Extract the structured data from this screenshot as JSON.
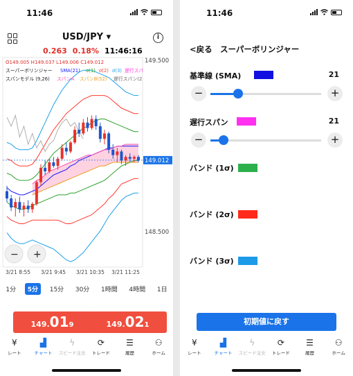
{
  "status": {
    "time": "11:46"
  },
  "chart_screen": {
    "pair": "USD/JPY",
    "change": "0.263",
    "change_pct": "0.18%",
    "clock": "11:46:16",
    "ohlc_line": "O149.005 H149.037 L149.006 C149.012",
    "legend_bb": {
      "prefix": "スーパーボリンジャー",
      "sma": "SMA(21)",
      "s1": "σ(1)",
      "s2": "σ(2)",
      "s3": "σ(3)",
      "lag": "遅行スパ"
    },
    "legend_span": {
      "prefix": "スパンモデル (9,26)",
      "a": "スパンA",
      "b": "スパンB(52)",
      "lag": "遅行スパン(2"
    },
    "price_labels": {
      "top": "149.500",
      "current": "149.012",
      "bottom": "148.500"
    },
    "time_labels": [
      "3/21 8:55",
      "3/21 9:45",
      "3/21 10:35",
      "3/21 11:25"
    ],
    "timeframes": [
      "1分",
      "5分",
      "15分",
      "30分",
      "1時間",
      "4時間",
      "1日"
    ],
    "selected_timeframe": "5分",
    "sell": {
      "small": "149.",
      "big": "01",
      "tail": "9"
    },
    "buy": {
      "small": "149.",
      "big": "02",
      "tail": "1"
    },
    "colors": {
      "price_red": "#f04e3e",
      "sma": "#1a1aff",
      "sigma1": "#2ca02c",
      "sigma2": "#ff3b30",
      "sigma3": "#1ca0e8",
      "lag": "#ff3de0"
    },
    "chart_data": {
      "type": "line",
      "title": "USD/JPY 5分",
      "ylim": [
        148.42,
        149.58
      ],
      "x": [
        "3/21 8:55",
        "3/21 9:45",
        "3/21 10:35",
        "3/21 11:25"
      ],
      "candles": [
        [
          148.84,
          148.87,
          148.78,
          148.8
        ],
        [
          148.8,
          148.82,
          148.73,
          148.75
        ],
        [
          148.75,
          148.8,
          148.7,
          148.78
        ],
        [
          148.78,
          148.81,
          148.72,
          148.74
        ],
        [
          148.74,
          148.78,
          148.7,
          148.76
        ],
        [
          148.76,
          148.79,
          148.72,
          148.74
        ],
        [
          148.74,
          148.78,
          148.72,
          148.77
        ],
        [
          148.77,
          148.9,
          148.76,
          148.89
        ],
        [
          148.89,
          148.99,
          148.87,
          148.97
        ],
        [
          148.97,
          149.01,
          148.93,
          148.95
        ],
        [
          148.95,
          149.02,
          148.94,
          149.0
        ],
        [
          149.0,
          149.03,
          148.97,
          148.98
        ],
        [
          148.98,
          149.03,
          148.96,
          149.02
        ],
        [
          149.02,
          149.1,
          149.01,
          149.08
        ],
        [
          149.08,
          149.11,
          149.04,
          149.06
        ],
        [
          149.06,
          149.12,
          149.05,
          149.11
        ],
        [
          149.11,
          149.2,
          149.1,
          149.18
        ],
        [
          149.18,
          149.22,
          149.14,
          149.16
        ],
        [
          149.16,
          149.24,
          149.15,
          149.22
        ],
        [
          149.22,
          149.25,
          149.17,
          149.19
        ],
        [
          149.19,
          149.26,
          149.18,
          149.24
        ],
        [
          149.24,
          149.26,
          149.18,
          149.2
        ],
        [
          149.2,
          149.22,
          149.11,
          149.13
        ],
        [
          149.13,
          149.18,
          149.1,
          149.16
        ],
        [
          149.16,
          149.17,
          149.05,
          149.07
        ],
        [
          149.07,
          149.1,
          149.02,
          149.04
        ],
        [
          149.04,
          149.08,
          149.0,
          149.06
        ],
        [
          149.06,
          149.07,
          148.99,
          149.01
        ],
        [
          149.01,
          149.04,
          148.98,
          149.03
        ],
        [
          149.03,
          149.05,
          149.0,
          149.02
        ],
        [
          149.02,
          149.04,
          149.0,
          149.03
        ],
        [
          149.03,
          149.04,
          149.0,
          149.01
        ]
      ],
      "series": [
        {
          "name": "SMA(21)",
          "color": "#1a1aff",
          "values": [
            148.86,
            148.84,
            148.83,
            148.82,
            148.82,
            148.83,
            148.84,
            148.85,
            148.87,
            148.89,
            148.91,
            148.93,
            148.94,
            148.95,
            148.96,
            148.98,
            148.99,
            149.01,
            149.02,
            149.03,
            149.04,
            149.05,
            149.06,
            149.07,
            149.08,
            149.08,
            149.09,
            149.09,
            149.09,
            149.09,
            149.09,
            149.09
          ]
        },
        {
          "name": "σ(1)+",
          "color": "#2ca02c",
          "values": [
            148.94,
            148.93,
            148.91,
            148.9,
            148.9,
            148.9,
            148.91,
            148.93,
            148.96,
            148.99,
            149.02,
            149.05,
            149.07,
            149.09,
            149.11,
            149.13,
            149.15,
            149.17,
            149.19,
            149.2,
            149.22,
            149.23,
            149.24,
            149.24,
            149.23,
            149.22,
            149.21,
            149.2,
            149.19,
            149.18,
            149.17,
            149.17
          ]
        },
        {
          "name": "σ(1)-",
          "color": "#2ca02c",
          "values": [
            148.78,
            148.76,
            148.75,
            148.74,
            148.74,
            148.75,
            148.76,
            148.77,
            148.78,
            148.79,
            148.8,
            148.81,
            148.82,
            148.82,
            148.82,
            148.83,
            148.83,
            148.84,
            148.85,
            148.86,
            148.87,
            148.88,
            148.89,
            148.9,
            148.92,
            148.94,
            148.96,
            148.98,
            148.99,
            149.0,
            149.01,
            149.01
          ]
        },
        {
          "name": "σ(2)+",
          "color": "#ff3b30",
          "values": [
            149.02,
            149.01,
            148.99,
            148.98,
            148.98,
            148.98,
            148.99,
            149.02,
            149.06,
            149.1,
            149.14,
            149.18,
            149.21,
            149.24,
            149.27,
            149.29,
            149.31,
            149.33,
            149.35,
            149.36,
            149.37,
            149.37,
            149.37,
            149.37,
            149.36,
            149.34,
            149.32,
            149.3,
            149.29,
            149.28,
            149.27,
            149.27
          ]
        },
        {
          "name": "σ(2)-",
          "color": "#ff3b30",
          "values": [
            148.7,
            148.68,
            148.67,
            148.66,
            148.66,
            148.67,
            148.68,
            148.68,
            148.68,
            148.68,
            148.68,
            148.68,
            148.68,
            148.67,
            148.66,
            148.66,
            148.67,
            148.68,
            148.69,
            148.7,
            148.71,
            148.73,
            148.75,
            148.77,
            148.8,
            148.82,
            148.85,
            148.88,
            148.89,
            148.9,
            148.91,
            148.91
          ]
        },
        {
          "name": "σ(3)+",
          "color": "#1ca0e8",
          "values": [
            149.11,
            149.1,
            149.08,
            149.07,
            149.07,
            149.07,
            149.08,
            149.12,
            149.17,
            149.22,
            149.27,
            149.32,
            149.36,
            149.4,
            149.43,
            149.46,
            149.48,
            149.5,
            149.51,
            149.51,
            149.51,
            149.5,
            149.49,
            149.48,
            149.47,
            149.45,
            149.43,
            149.41,
            149.39,
            149.38,
            149.37,
            149.37
          ]
        },
        {
          "name": "σ(3)-",
          "color": "#1ca0e8",
          "values": [
            148.61,
            148.58,
            148.56,
            148.55,
            148.55,
            148.56,
            148.57,
            148.56,
            148.55,
            148.54,
            148.53,
            148.52,
            148.5,
            148.48,
            148.46,
            148.45,
            148.46,
            148.48,
            148.5,
            148.53,
            148.56,
            148.59,
            148.62,
            148.66,
            148.7,
            148.73,
            148.76,
            148.79,
            148.81,
            148.82,
            148.83,
            148.83
          ]
        },
        {
          "name": "遅行スパン",
          "color": "#b0b0b0",
          "values": [
            149.25,
            149.2,
            149.26,
            149.14,
            149.2,
            149.1,
            149.16,
            149.08,
            149.12,
            149.06,
            149.1,
            149.12,
            149.18,
            149.22,
            149.24,
            149.2,
            149.22,
            149.17,
            149.13,
            null,
            null,
            null,
            null,
            null,
            null,
            null,
            null,
            null,
            null,
            null,
            null,
            null
          ]
        },
        {
          "name": "スパンA",
          "color": "#ff4fb0",
          "values": [
            null,
            null,
            null,
            null,
            null,
            null,
            148.88,
            148.9,
            148.91,
            148.93,
            148.95,
            148.96,
            148.97,
            148.98,
            148.99,
            149.0,
            149.01,
            149.02,
            149.03,
            149.04,
            149.04,
            149.05,
            149.06,
            149.07,
            149.07,
            149.08,
            149.09,
            149.09,
            149.1,
            149.1,
            149.1,
            149.1
          ]
        },
        {
          "name": "スパンB(52)",
          "color": "#e8a020",
          "values": [
            null,
            null,
            null,
            null,
            null,
            null,
            148.82,
            148.83,
            148.84,
            148.85,
            148.86,
            148.87,
            148.88,
            148.89,
            148.9,
            148.91,
            148.92,
            148.93,
            148.94,
            148.95,
            148.96,
            148.97,
            148.98,
            148.98,
            148.99,
            149.0,
            149.0,
            149.0,
            149.0,
            149.0,
            149.0,
            149.0
          ]
        }
      ]
    },
    "tabs": [
      {
        "label": "レート",
        "icon": "currency-yen-icon"
      },
      {
        "label": "チャート",
        "icon": "chart-icon"
      },
      {
        "label": "スピード注文",
        "icon": "lightning-icon"
      },
      {
        "label": "トレード",
        "icon": "trade-cycle-icon"
      },
      {
        "label": "履歴",
        "icon": "history-list-icon"
      },
      {
        "label": "ホーム",
        "icon": "people-icon"
      }
    ],
    "active_tab": "チャート"
  },
  "settings_screen": {
    "back": "<戻る",
    "title": "スーパーボリンジャー",
    "rows": [
      {
        "label": "基準線 (SMA)",
        "color": "#1010e0",
        "value": "21",
        "slider_fraction": 0.25
      },
      {
        "label": "遅行スパン",
        "color": "#ff30f0",
        "value": "21",
        "slider_fraction": 0.12
      },
      {
        "label": "バンド (1σ)",
        "color": "#2cb04c"
      },
      {
        "label": "バンド (2σ)",
        "color": "#ff2a1a"
      },
      {
        "label": "バンド (3σ)",
        "color": "#1c9ae8"
      }
    ],
    "reset": "初期値に戻す"
  }
}
